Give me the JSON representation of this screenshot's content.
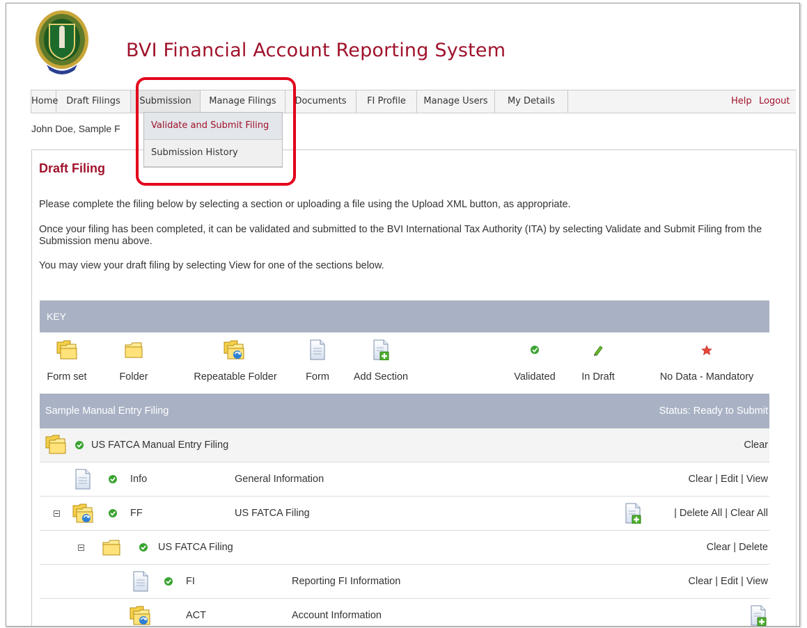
{
  "app": {
    "title": "BVI Financial Account Reporting System"
  },
  "nav": {
    "items": [
      "Home",
      "Draft Filings",
      "Submission",
      "Manage Filings",
      "Documents",
      "FI Profile",
      "Manage Users",
      "My Details"
    ],
    "help": "Help",
    "logout": "Logout"
  },
  "dropdown": {
    "items": [
      "Validate and Submit Filing",
      "Submission History"
    ]
  },
  "user_line": "John Doe, Sample F",
  "panel": {
    "title": "Draft Filing",
    "para1": "Please complete the filing below by selecting a section or uploading a file using the Upload XML button, as appropriate.",
    "para2": "Once your filing has been completed, it can be validated and submitted to the BVI International Tax Authority (ITA) by selecting Validate and Submit Filing from the Submission menu above.",
    "para3": "You may view your draft filing by selecting View for one of the sections below."
  },
  "key": {
    "title": "KEY",
    "items": [
      {
        "label": "Form set",
        "icon": "form-set-icon"
      },
      {
        "label": "Folder",
        "icon": "folder-icon"
      },
      {
        "label": "Repeatable Folder",
        "icon": "repeatable-folder-icon"
      },
      {
        "label": "Form",
        "icon": "form-icon"
      },
      {
        "label": "Add Section",
        "icon": "add-section-icon"
      },
      {
        "label": "Validated",
        "icon": "validated-icon"
      },
      {
        "label": "In Draft",
        "icon": "in-draft-icon"
      },
      {
        "label": "No Data - Mandatory",
        "icon": "no-data-mandatory-icon"
      }
    ]
  },
  "filing": {
    "name": "Sample Manual Entry Filing",
    "status": "Status: Ready to Submit",
    "rows": [
      {
        "code": "US FATCA Manual Entry Filing",
        "desc": "",
        "actions": "Clear"
      },
      {
        "code": "Info",
        "desc": "General Information",
        "actions": "Clear | Edit | View"
      },
      {
        "code": "FF",
        "desc": "US FATCA Filing",
        "actions": "| Delete All | Clear All"
      },
      {
        "code": "US FATCA Filing",
        "desc": "",
        "actions": "Clear | Delete"
      },
      {
        "code": "FI",
        "desc": "Reporting FI Information",
        "actions": "Clear | Edit | View"
      },
      {
        "code": "ACT",
        "desc": "Account Information",
        "actions": ""
      }
    ]
  },
  "colors": {
    "accent": "#a0122b",
    "bar": "#a9b2c4",
    "highlight": "#e3001b",
    "validated": "#3aa431"
  }
}
